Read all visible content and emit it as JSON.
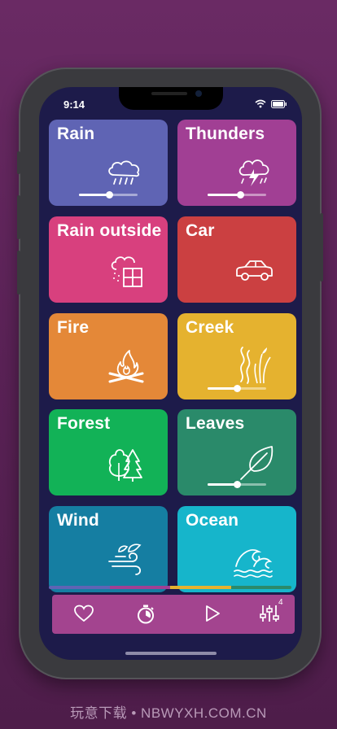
{
  "status": {
    "time": "9:14"
  },
  "tiles": [
    {
      "name": "Rain",
      "color": "#5f64b4",
      "icon": "rain-cloud-icon",
      "slider": 0.52
    },
    {
      "name": "Thunders",
      "color": "#a13f94",
      "icon": "thunder-cloud-icon",
      "slider": 0.55
    },
    {
      "name": "Rain outside",
      "color": "#d8407e",
      "icon": "rain-window-icon",
      "slider": null
    },
    {
      "name": "Car",
      "color": "#cb4041",
      "icon": "car-icon",
      "slider": null
    },
    {
      "name": "Fire",
      "color": "#e48838",
      "icon": "campfire-icon",
      "slider": null
    },
    {
      "name": "Creek",
      "color": "#e5b22f",
      "icon": "creek-icon",
      "slider": 0.5
    },
    {
      "name": "Forest",
      "color": "#12b257",
      "icon": "trees-icon",
      "slider": null
    },
    {
      "name": "Leaves",
      "color": "#2a8a6a",
      "icon": "leaf-icon",
      "slider": 0.5
    },
    {
      "name": "Wind",
      "color": "#157ea2",
      "icon": "wind-icon",
      "slider": null
    },
    {
      "name": "Ocean",
      "color": "#16b5cb",
      "icon": "wave-icon",
      "slider": null
    }
  ],
  "progress_colors": [
    "#5f64b4",
    "#a13f94",
    "#e5b22f",
    "#2a8a6a"
  ],
  "tabbar": {
    "color": "#a3448f",
    "tabs": [
      {
        "icon": "heart-icon"
      },
      {
        "icon": "timer-icon"
      },
      {
        "icon": "play-icon"
      },
      {
        "icon": "mixer-icon",
        "badge": "4"
      }
    ]
  },
  "watermark": "玩意下载 • NBWYXH.COM.CN"
}
